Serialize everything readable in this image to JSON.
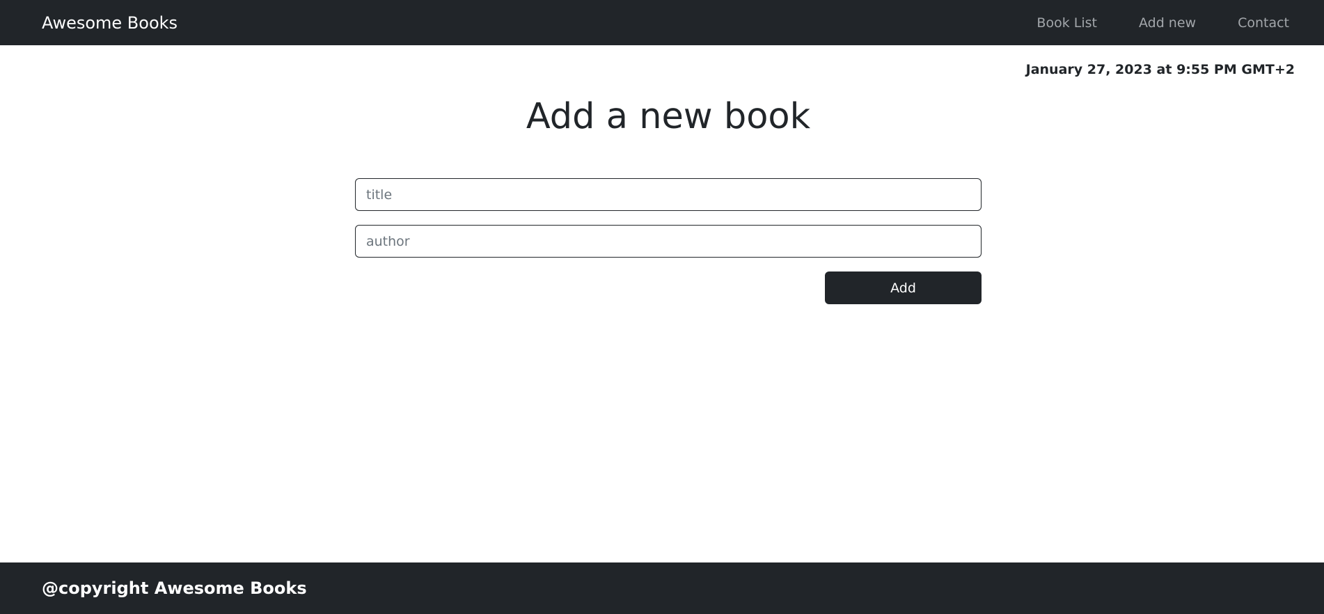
{
  "navbar": {
    "brand": "Awesome Books",
    "links": [
      {
        "label": "Book List"
      },
      {
        "label": "Add new"
      },
      {
        "label": "Contact"
      }
    ]
  },
  "date": "January 27, 2023 at 9:55 PM GMT+2",
  "main": {
    "heading": "Add a new book",
    "title_placeholder": "title",
    "title_value": "",
    "author_placeholder": "author",
    "author_value": "",
    "add_label": "Add"
  },
  "footer": {
    "text": "@copyright Awesome Books"
  },
  "colors": {
    "dark": "#212529",
    "nav_link": "#a3a7ab",
    "background": "#ffffff"
  }
}
